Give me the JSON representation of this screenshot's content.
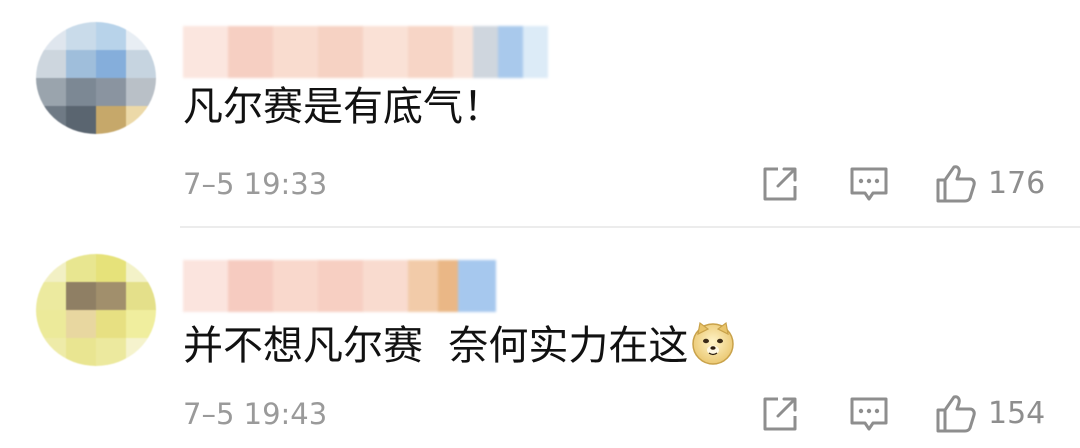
{
  "comments": [
    {
      "text": "凡尔赛是有底气！",
      "time": "7–5 19:33",
      "likes": "176",
      "has_emoji": false
    },
    {
      "text": "并不想凡尔赛  奈何实力在这",
      "time": "7–5 19:43",
      "likes": "154",
      "has_emoji": true,
      "emoji": "doge-icon"
    }
  ],
  "icons": {
    "share": "share-icon",
    "reply": "comment-icon",
    "like": "thumbs-up-icon"
  },
  "colors": {
    "text": "#111111",
    "meta": "#9a9a9a",
    "icon": "#8e8e8e",
    "divider": "#ececec"
  }
}
